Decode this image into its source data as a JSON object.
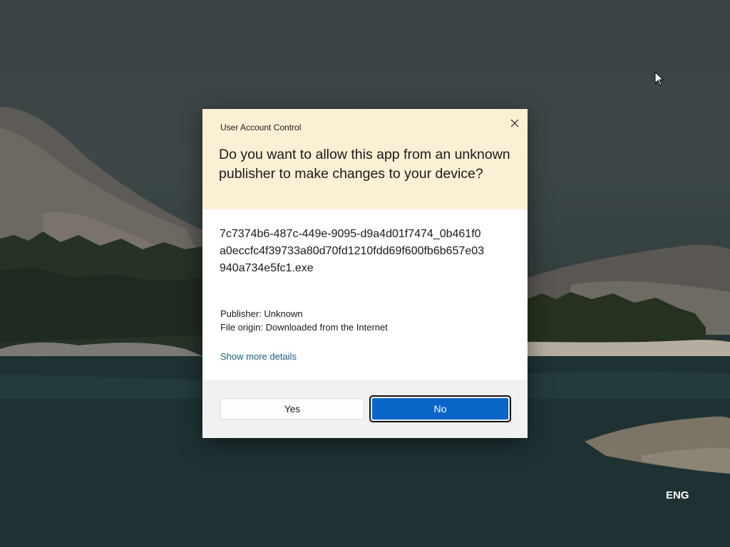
{
  "dialog": {
    "title": "User Account Control",
    "question": "Do you want to allow this app from an unknown publisher to make changes to your device?",
    "app_name": "7c7374b6-487c-449e-9095-d9a4d01f7474_0b461f0a0eccfc4f39733a80d70fd1210fdd69f600fb6b657e03940a734e5fc1.exe",
    "publisher": "Publisher: Unknown",
    "file_origin": "File origin: Downloaded from the Internet",
    "more_details_link": "Show more details",
    "yes_label": "Yes",
    "no_label": "No",
    "close_icon": "close-icon"
  },
  "system": {
    "language": "ENG"
  },
  "colors": {
    "header_bg": "#fcf0d4",
    "primary_button": "#0a66c8",
    "link": "#1a5e7e",
    "footer_bg": "#f1f1f1"
  }
}
